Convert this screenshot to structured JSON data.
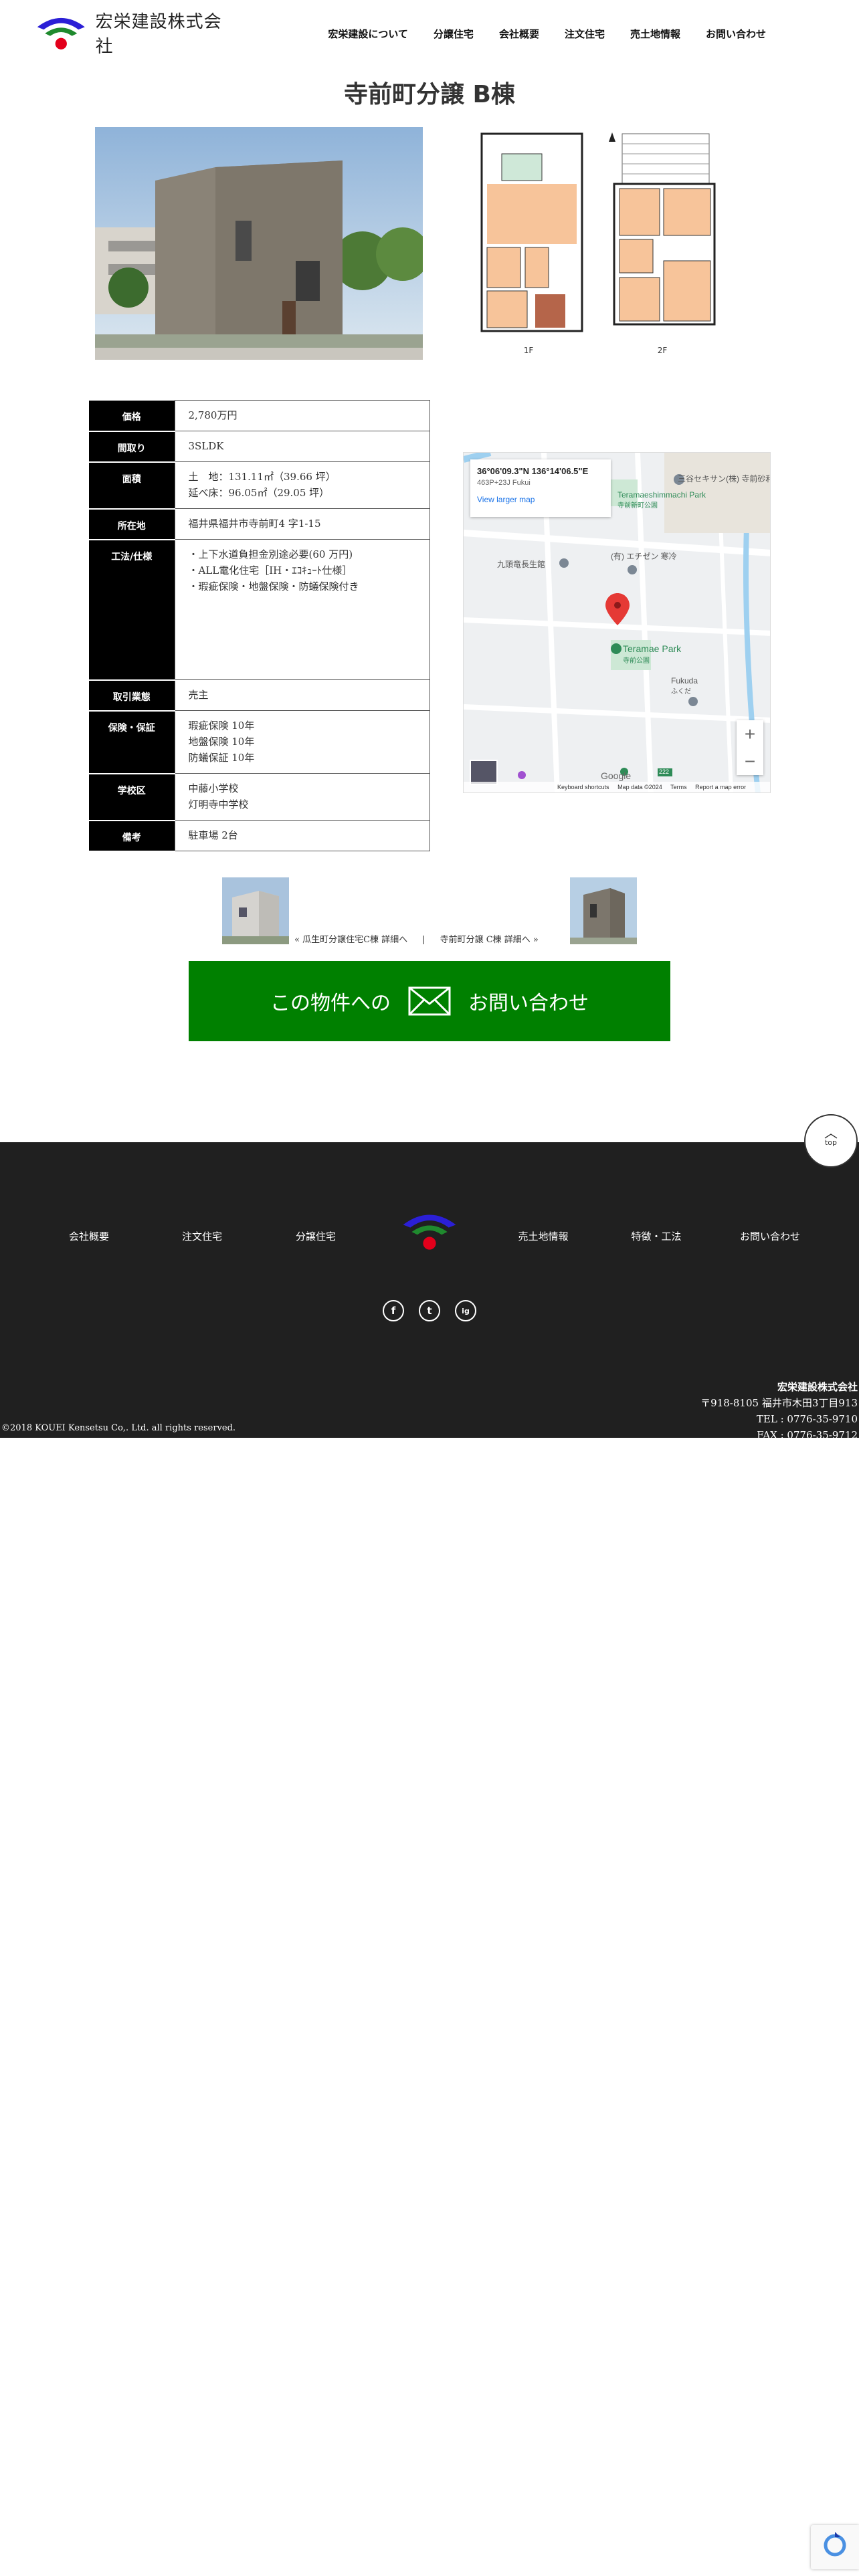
{
  "header": {
    "logo_text": "宏栄建設株式会社",
    "nav": [
      "宏栄建設について",
      "分譲住宅",
      "会社概要",
      "注文住宅",
      "売土地情報",
      "お問い合わせ"
    ]
  },
  "page_title": "寺前町分譲 B棟",
  "floorplan": {
    "floor1": "1F",
    "floor2": "2F"
  },
  "spec": {
    "price_label": "価格",
    "price": "2,780万円",
    "layout_label": "間取り",
    "layout": "3SLDK",
    "area_label": "面積",
    "area_line1": "土　地：131.11㎡（39.66 坪）",
    "area_line2": "延べ床：96.05㎡（29.05 坪）",
    "address_label": "所在地",
    "address": "福井県福井市寺前町4 字1-15",
    "construction_label": "工法/仕様",
    "construction_line1": "・上下水道負担金別途必要(60 万円)",
    "construction_line2": "・ALL電化住宅［IH・ｴｺｷｭｰﾄ仕様］",
    "construction_line3": "・瑕疵保険・地盤保険・防蟻保険付き",
    "transaction_label": "取引業態",
    "transaction": "売主",
    "warranty_label": "保険・保証",
    "warranty_line1": "瑕疵保険 10年",
    "warranty_line2": "地盤保険 10年",
    "warranty_line3": "防蟻保証 10年",
    "school_label": "学校区",
    "school_line1": "中藤小学校",
    "school_line2": "灯明寺中学校",
    "notes_label": "備考",
    "notes": "駐車場 2台"
  },
  "map": {
    "coords": "36°06'09.3\"N 136°14'06.5\"E",
    "plus_code": "463P+23J Fukui",
    "larger_map": "View larger map",
    "label_park1": "Teramaeshimmachi Park",
    "label_park1_jp": "寺前新町公園",
    "label_company1": "三谷セキサン(株) 寺前砂利工場",
    "label_hall": "九頭竜長生館",
    "label_company2": "(有) エチゼン 寒冷",
    "label_park2": "Teramae Park",
    "label_park2_jp": "寺前公園",
    "label_fukuda": "Fukuda",
    "label_fukuda_jp": "ふくだ",
    "zoom_in": "+",
    "zoom_out": "−",
    "footer_shortcuts": "Keyboard shortcuts",
    "footer_data": "Map data ©2024",
    "footer_terms": "Terms",
    "footer_report": "Report a map error",
    "google": "Google",
    "road_num": "222"
  },
  "prevnext": {
    "prev_label": "« 瓜生町分譲住宅C棟 詳細へ",
    "sep": "|",
    "next_label": "寺前町分譲 C棟 詳細へ »"
  },
  "cta": {
    "left": "この物件への",
    "right": "お問い合わせ"
  },
  "footer": {
    "nav": [
      "会社概要",
      "注文住宅",
      "分譲住宅",
      "売土地情報",
      "特徴・工法",
      "お問い合わせ"
    ],
    "social": [
      "f",
      "t",
      "ig"
    ],
    "company_name": "宏栄建設株式会社",
    "address": "〒918-8105 福井市木田3丁目913",
    "tel": "TEL : 0776-35-9710",
    "fax": "FAX : 0776-35-9712",
    "copyright": "©2018 KOUEI Kensetsu Co,. Ltd. all rights reserved."
  },
  "top_button": "top",
  "colors": {
    "cta": "#008000",
    "footer": "#202020",
    "logo_blue": "#2b1fd6",
    "logo_green": "#1f8a2e",
    "logo_red": "#e3001b"
  }
}
